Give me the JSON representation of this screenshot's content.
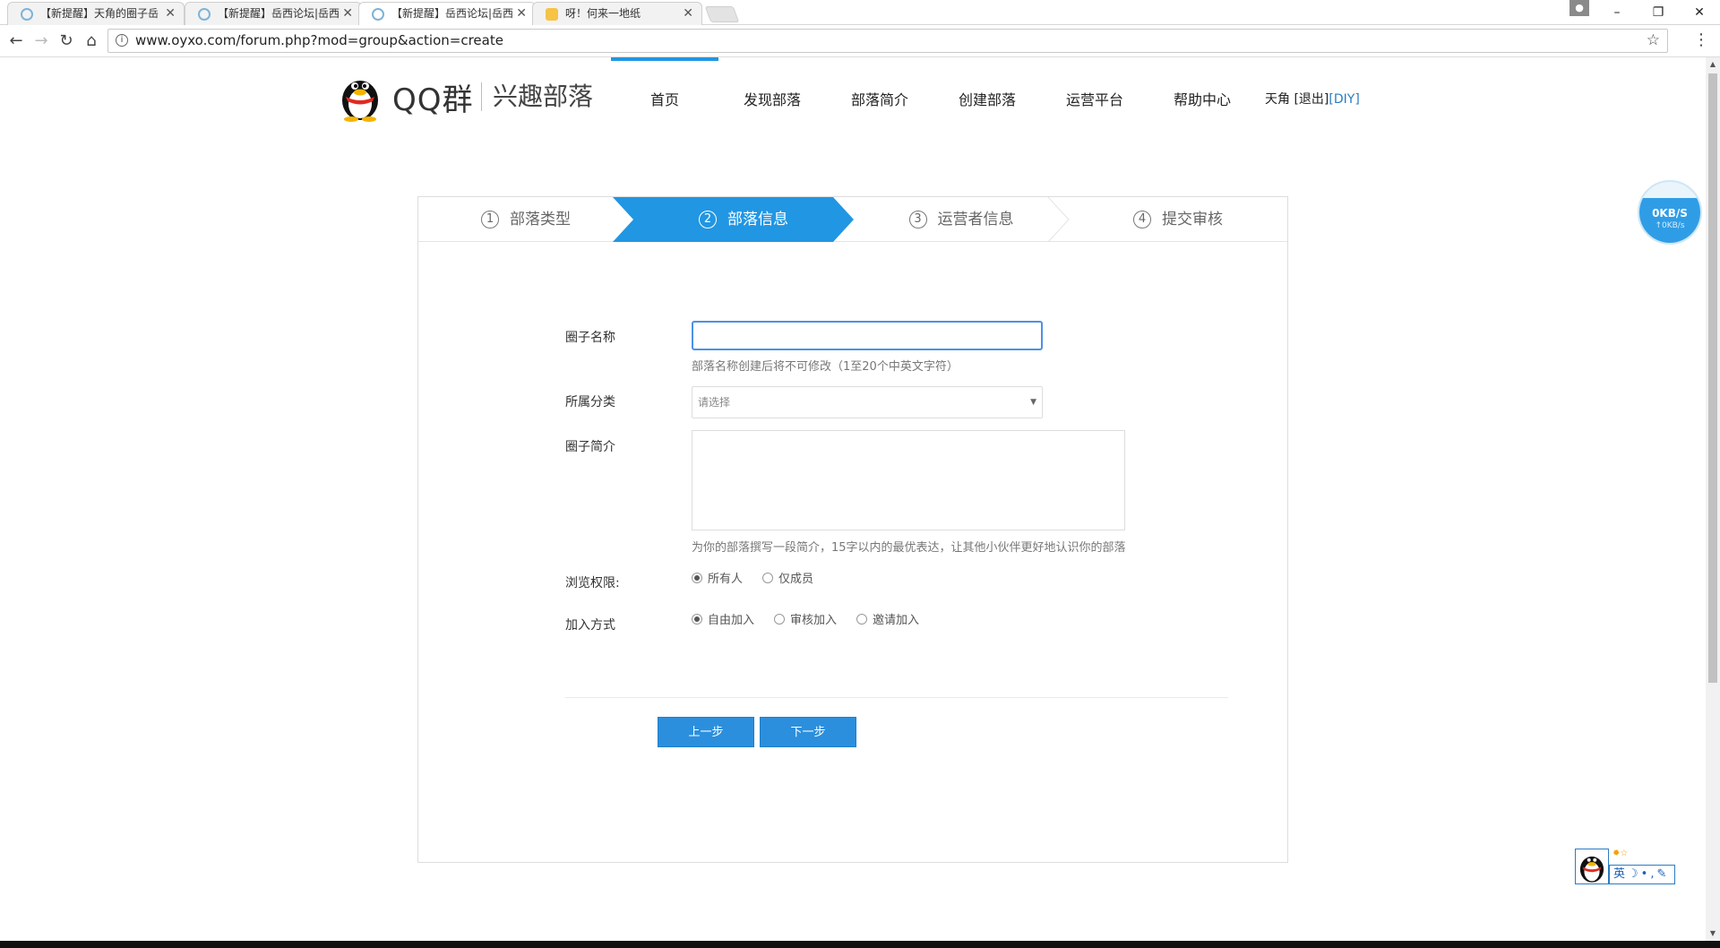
{
  "browser": {
    "tabs": [
      {
        "title": "【新提醒】天角的圈子岳"
      },
      {
        "title": "【新提醒】岳西论坛|岳西"
      },
      {
        "title": "【新提醒】岳西论坛|岳西"
      },
      {
        "title": "呀！何来一地纸"
      }
    ],
    "url": "www.oyxo.com/forum.php?mod=group&action=create",
    "window_controls": {
      "minimize": "–",
      "restore": "❐",
      "close": "✕"
    }
  },
  "site": {
    "brand": "QQ群",
    "brand_sub": "兴趣部落",
    "nav": [
      {
        "label": "首页"
      },
      {
        "label": "发现部落"
      },
      {
        "label": "部落简介"
      },
      {
        "label": "创建部落"
      },
      {
        "label": "运营平台"
      },
      {
        "label": "帮助中心"
      }
    ],
    "user": {
      "name": "天角",
      "logout": "[退出]",
      "diy": "[DIY]"
    }
  },
  "wizard": {
    "steps": [
      {
        "num": "1",
        "label": "部落类型"
      },
      {
        "num": "2",
        "label": "部落信息"
      },
      {
        "num": "3",
        "label": "运营者信息"
      },
      {
        "num": "4",
        "label": "提交审核"
      }
    ],
    "active_step": 2,
    "fields": {
      "name_label": "圈子名称",
      "name_value": "",
      "name_hint": "部落名称创建后将不可修改（1至20个中英文字符）",
      "category_label": "所属分类",
      "category_value": "请选择",
      "intro_label": "圈子简介",
      "intro_value": "",
      "intro_hint": "为你的部落撰写一段简介，15字以内的最优表达，让其他小伙伴更好地认识你的部落",
      "view_label": "浏览权限:",
      "view_options": [
        {
          "label": "所有人",
          "selected": true
        },
        {
          "label": "仅成员",
          "selected": false
        }
      ],
      "join_label": "加入方式",
      "join_options": [
        {
          "label": "自由加入",
          "selected": true
        },
        {
          "label": "审核加入",
          "selected": false
        },
        {
          "label": "邀请加入",
          "selected": false
        }
      ]
    },
    "buttons": {
      "prev": "上一步",
      "next": "下一步"
    }
  },
  "speed_widget": {
    "down": "0KB/S",
    "up": "↑0KB/s"
  },
  "ime": {
    "mode": "英"
  },
  "colors": {
    "accent": "#2b8fde",
    "active_step": "#2196e3",
    "link": "#2b7cc3"
  }
}
